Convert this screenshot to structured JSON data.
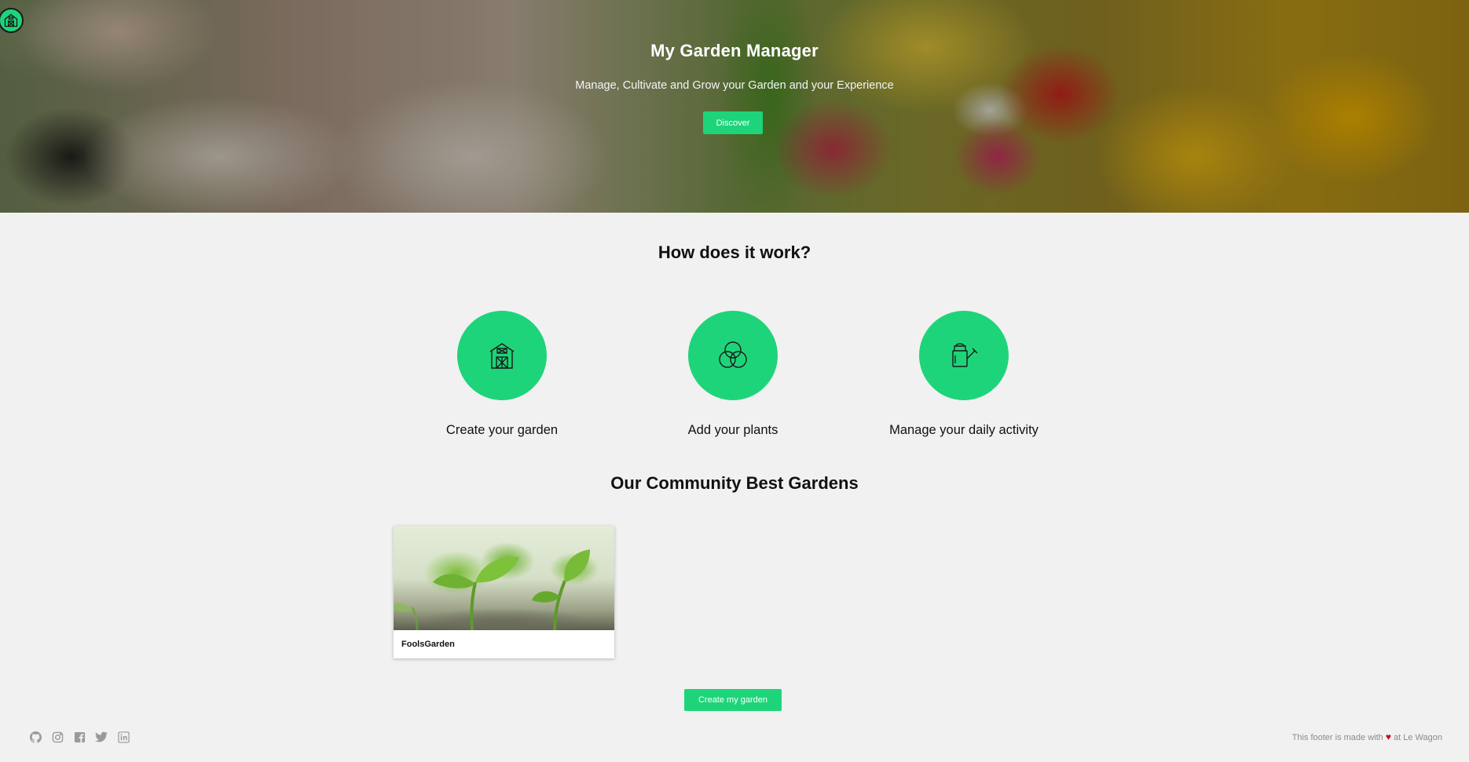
{
  "hero": {
    "title": "My Garden Manager",
    "subtitle": "Manage, Cultivate and Grow your Garden and your Experience",
    "discover_label": "Discover"
  },
  "how": {
    "title": "How does it work?",
    "steps": [
      {
        "label": "Create your garden",
        "icon": "barn-icon"
      },
      {
        "label": "Add your plants",
        "icon": "venn-circles-icon"
      },
      {
        "label": "Manage your daily activity",
        "icon": "watering-can-icon"
      }
    ]
  },
  "community": {
    "title": "Our Community Best Gardens",
    "gardens": [
      {
        "name": "FoolsGarden"
      }
    ]
  },
  "create_button_label": "Create my garden",
  "footer": {
    "icons": [
      "github-icon",
      "instagram-icon",
      "facebook-icon",
      "twitter-icon",
      "linkedin-icon"
    ],
    "note_prefix": "This footer is made with",
    "note_suffix": "at Le Wagon"
  },
  "colors": {
    "accent": "#1ed47a",
    "background": "#f1f1f1"
  }
}
